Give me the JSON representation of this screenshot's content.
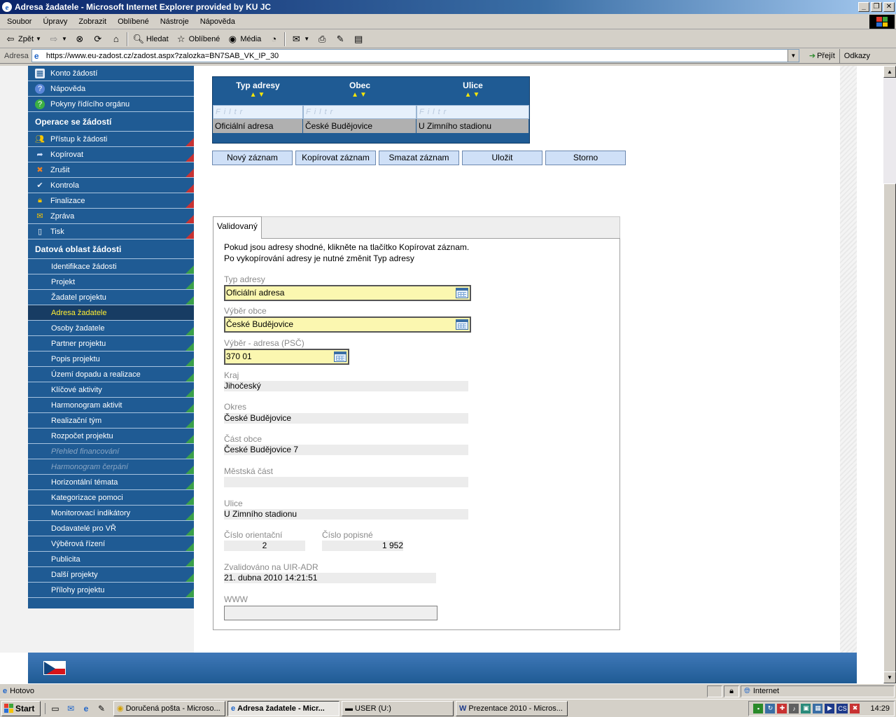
{
  "window": {
    "title": "Adresa žadatele - Microsoft Internet Explorer provided by KU JC"
  },
  "menu": [
    "Soubor",
    "Úpravy",
    "Zobrazit",
    "Oblíbené",
    "Nástroje",
    "Nápověda"
  ],
  "toolbar": {
    "back": "Zpět",
    "search": "Hledat",
    "favorites": "Oblíbené",
    "media": "Média"
  },
  "address": {
    "label": "Adresa",
    "url": "https://www.eu-zadost.cz/zadost.aspx?zalozka=BN7SAB_VK_IP_30",
    "go": "Přejít",
    "links": "Odkazy"
  },
  "sidebar": {
    "top_items": [
      {
        "label": "Konto žádostí",
        "icon": "account-icon"
      },
      {
        "label": "Nápověda",
        "icon": "help-icon"
      },
      {
        "label": "Pokyny řídícího orgánu",
        "icon": "guidelines-icon"
      }
    ],
    "section_ops": "Operace se žádostí",
    "ops_items": [
      {
        "label": "Přístup k žádosti",
        "icon": "users-icon"
      },
      {
        "label": "Kopírovat",
        "icon": "copy-arrow-icon"
      },
      {
        "label": "Zrušit",
        "icon": "cancel-icon"
      },
      {
        "label": "Kontrola",
        "icon": "check-icon"
      },
      {
        "label": "Finalizace",
        "icon": "lock-icon"
      },
      {
        "label": "Zpráva",
        "icon": "mail-icon"
      },
      {
        "label": "Tisk",
        "icon": "print-icon"
      }
    ],
    "section_data": "Datová oblast žádosti",
    "data_items": [
      {
        "label": "Identifikace žádosti"
      },
      {
        "label": "Projekt"
      },
      {
        "label": "Žadatel projektu"
      },
      {
        "label": "Adresa žadatele",
        "active": true
      },
      {
        "label": "Osoby žadatele"
      },
      {
        "label": "Partner projektu"
      },
      {
        "label": "Popis projektu"
      },
      {
        "label": "Území dopadu a realizace"
      },
      {
        "label": "Klíčové aktivity"
      },
      {
        "label": "Harmonogram aktivit"
      },
      {
        "label": "Realizační tým"
      },
      {
        "label": "Rozpočet projektu"
      },
      {
        "label": "Přehled financování",
        "disabled": true
      },
      {
        "label": "Harmonogram čerpání",
        "disabled": true
      },
      {
        "label": "Horizontální témata"
      },
      {
        "label": "Kategorizace pomoci"
      },
      {
        "label": "Monitorovací indikátory"
      },
      {
        "label": "Dodavatelé pro VŘ"
      },
      {
        "label": "Výběrová řízení"
      },
      {
        "label": "Publicita"
      },
      {
        "label": "Další projekty"
      },
      {
        "label": "Přílohy projektu"
      }
    ]
  },
  "grid": {
    "columns": [
      "Typ adresy",
      "Obec",
      "Ulice"
    ],
    "filter_placeholder": "Filtr",
    "rows": [
      [
        "Oficiální adresa",
        "České Budějovice",
        "U Zimního stadionu"
      ]
    ]
  },
  "actions": {
    "new": "Nový záznam",
    "copy": "Kopírovat záznam",
    "delete": "Smazat záznam",
    "save": "Uložit",
    "cancel": "Storno"
  },
  "tab": {
    "label": "Validovaný"
  },
  "form": {
    "info1": "Pokud jsou adresy shodné, klikněte na tlačítko Kopírovat záznam.",
    "info2": "Po vykopírování adresy je nutné změnit Typ adresy",
    "typ_adresy": {
      "label": "Typ adresy",
      "value": "Oficiální adresa"
    },
    "vyber_obce": {
      "label": "Výběr obce",
      "value": "České Budějovice"
    },
    "vyber_adresa": {
      "label": "Výběr - adresa (PSČ)",
      "value": "370 01"
    },
    "kraj": {
      "label": "Kraj",
      "value": "Jihočeský"
    },
    "okres": {
      "label": "Okres",
      "value": "České Budějovice"
    },
    "cast_obce": {
      "label": "Část obce",
      "value": "České Budějovice 7"
    },
    "mestska_cast": {
      "label": "Městská část",
      "value": ""
    },
    "ulice": {
      "label": "Ulice",
      "value": "U Zimního stadionu"
    },
    "cislo_orientacni": {
      "label": "Číslo orientační",
      "value": "2"
    },
    "cislo_popisne": {
      "label": "Číslo popisné",
      "value": "1 952"
    },
    "zvalidovano": {
      "label": "Zvalidováno na UIR-ADR",
      "value": "21. dubna 2010 14:21:51"
    },
    "www": {
      "label": "WWW",
      "value": ""
    }
  },
  "status": {
    "text": "Hotovo",
    "zone": "Internet"
  },
  "taskbar": {
    "start": "Start",
    "tasks": [
      {
        "label": "Doručená pošta - Microso..."
      },
      {
        "label": "Adresa žadatele - Micr...",
        "active": true
      },
      {
        "label": "USER (U:)"
      },
      {
        "label": "Prezentace 2010 - Micros..."
      }
    ],
    "lang": "CS",
    "clock": "14:29"
  },
  "colors": {
    "sidebar": "#1f5b94",
    "active_item_text": "#ffee33",
    "select_bg": "#fbf7b0",
    "button_bg": "#cfe0f7"
  }
}
